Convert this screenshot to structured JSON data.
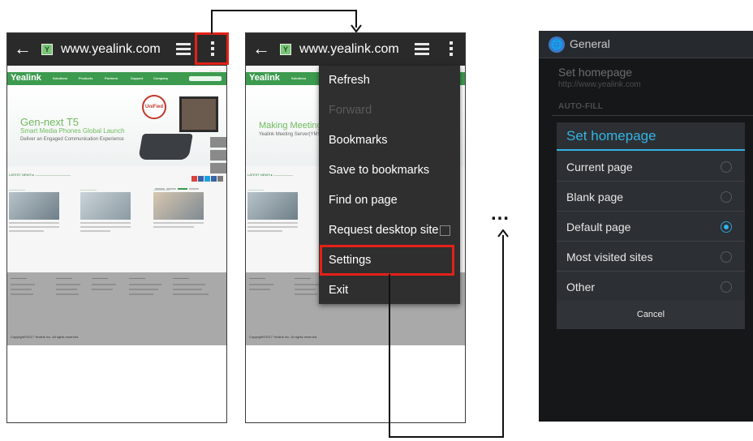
{
  "browser": {
    "url": "www.yealink.com",
    "favicon": "Y",
    "back_icon": "arrow-left-icon",
    "tabs_icon": "tab-switcher-icon",
    "menu_icon": "overflow-menu-icon"
  },
  "site": {
    "logo": "Yealink",
    "nav": [
      "Solutions",
      "Products",
      "Partners",
      "Support",
      "Company"
    ],
    "banner1": {
      "line1": "Gen-next T5",
      "line2": "Smart Media Phones Global Launch",
      "line3": "Deliver an Engaged Communication Experience"
    },
    "banner2": {
      "line1": "Making Meeting S",
      "line2": "Yealink Meeting Server(YMS)"
    },
    "unified_badge": "UniFied",
    "copyright": "Copyright©2017 Yealink Inc. All rights reserved."
  },
  "menu": {
    "items": [
      {
        "label": "Refresh",
        "enabled": true
      },
      {
        "label": "Forward",
        "enabled": false
      },
      {
        "label": "Bookmarks",
        "enabled": true
      },
      {
        "label": "Save to bookmarks",
        "enabled": true
      },
      {
        "label": "Find on page",
        "enabled": true
      },
      {
        "label": "Request desktop site",
        "enabled": true
      },
      {
        "label": "Settings",
        "enabled": true
      },
      {
        "label": "Exit",
        "enabled": true
      }
    ]
  },
  "ellipsis": "…",
  "settings": {
    "title": "General",
    "pref_title": "Set homepage",
    "pref_summary": "http://www.yealink.com",
    "section": "AUTO-FILL",
    "dialog": {
      "title": "Set homepage",
      "options": [
        "Current page",
        "Blank page",
        "Default page",
        "Most visited sites",
        "Other"
      ],
      "selected": "Default page",
      "cancel": "Cancel"
    }
  },
  "colors": {
    "highlight": "#e32118",
    "yealink_green": "#3d9b4f",
    "dialog_accent": "#34b4e4"
  }
}
